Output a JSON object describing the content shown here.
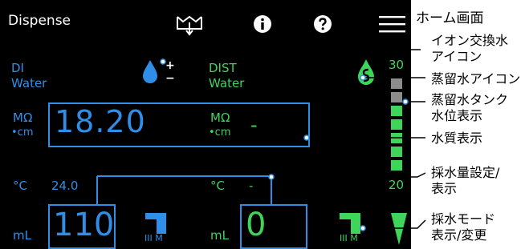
{
  "header": {
    "title": "Dispense"
  },
  "left_panel": {
    "name_line1": "DI",
    "name_line2": "Water",
    "resistivity_unit_top": "MΩ",
    "resistivity_unit_bottom": "•cm",
    "resistivity_value": "18.20",
    "temp_unit": "°C",
    "temp_value": "24.0",
    "volume_unit": "mL",
    "volume_value": "110",
    "mode_label": "III M",
    "ion_plus": "+",
    "ion_minus": "−"
  },
  "right_panel": {
    "name_line1": "DIST",
    "name_line2": "Water",
    "tank_top_label": "30",
    "resistivity_unit_top": "MΩ",
    "resistivity_unit_bottom": "•cm",
    "resistivity_value": "-",
    "temp_unit": "°C",
    "temp_value": "-",
    "tank_bottom_label": "20",
    "volume_unit": "mL",
    "volume_value": "0",
    "mode_label": "III M"
  },
  "tank": {
    "segments": [
      "empty",
      "empty",
      "full",
      "full",
      "full",
      "full",
      "full"
    ]
  },
  "callouts": {
    "home": "ホーム画面",
    "ion_icon_1": "イオン交換水",
    "ion_icon_2": "アイコン",
    "dist_icon": "蒸留水アイコン",
    "tank_1": "蒸留水タンク",
    "tank_2": "水位表示",
    "quality": "水質表示",
    "volume_1": "採水量設定/",
    "volume_2": "表示",
    "mode_1": "採水モード",
    "mode_2": "表示/変更"
  },
  "colors": {
    "blue": "#2f8fe8",
    "green": "#3fd45a",
    "gray": "#8c8c8c"
  }
}
